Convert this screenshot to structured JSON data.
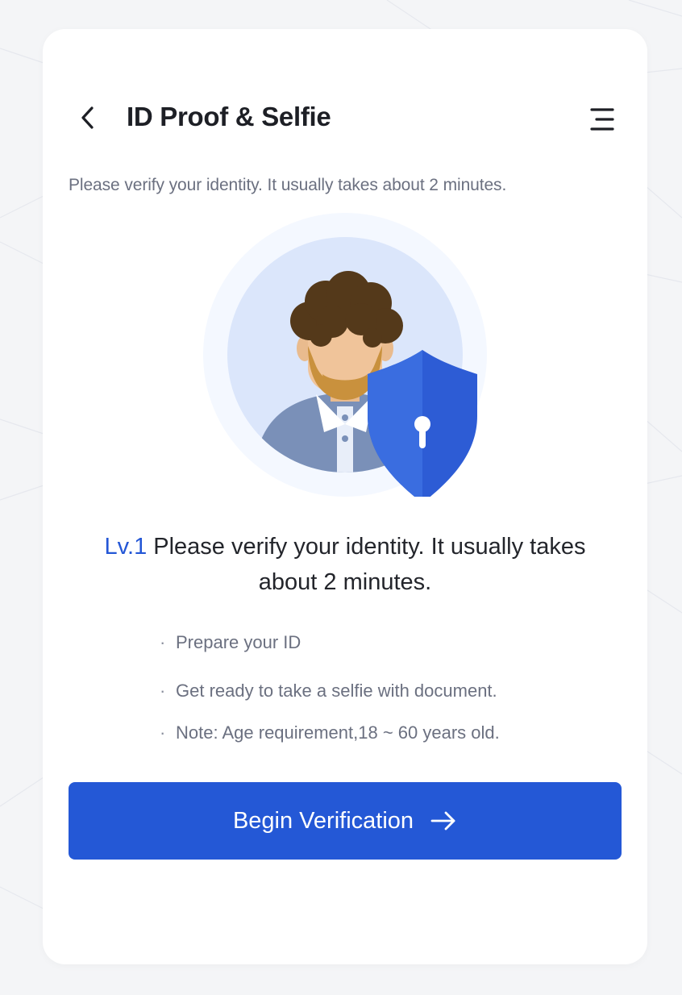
{
  "header": {
    "title": "ID Proof & Selfie",
    "back_icon": "chevron-left-icon",
    "menu_icon": "menu-icon"
  },
  "intro_text": "Please verify your identity. It usually takes about 2 minutes.",
  "illustration": {
    "description_icon": "verified-user-shield-icon"
  },
  "headline": {
    "level": "Lv.1",
    "text": "Please verify your identity. It usually takes about 2 minutes."
  },
  "requirements": [
    "Prepare your ID",
    "Get ready to take a selfie with document.",
    "Note: Age requirement,18 ~ 60 years old."
  ],
  "cta": {
    "label": "Begin Verification",
    "icon": "arrow-right-icon"
  },
  "colors": {
    "primary": "#2458d6",
    "title": "#1d1f25",
    "muted": "#6b7080",
    "background": "#f4f5f7"
  }
}
